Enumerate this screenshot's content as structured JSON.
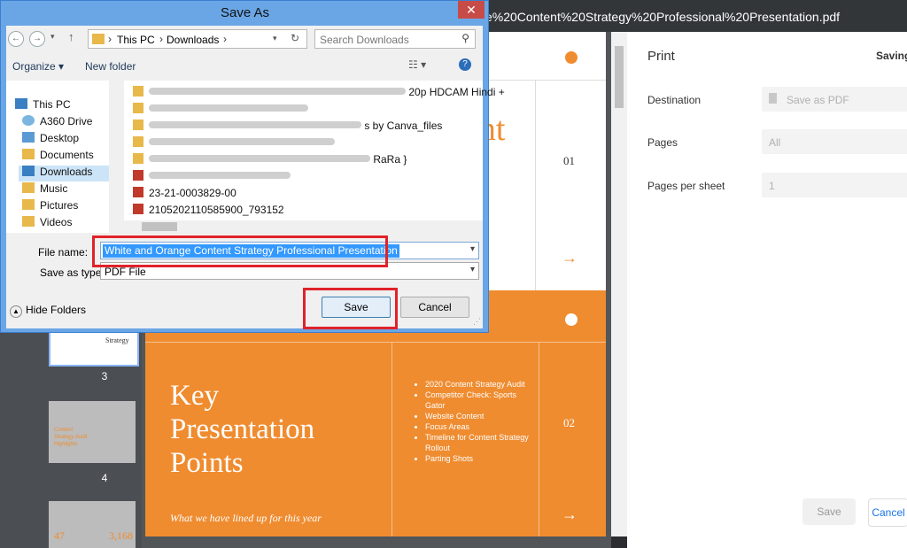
{
  "pdf_title": "e%20Content%20Strategy%20Professional%20Presentation.pdf",
  "thumb_numbers": [
    "3",
    "4"
  ],
  "thumb_texts": {
    "t1": "Strategy",
    "t2a": "Content",
    "t2b": "Strategy Audit",
    "t2c": "Highlights",
    "t3a": "47",
    "t3b": "3,168"
  },
  "slide1": {
    "title_part": "ent",
    "number": "01",
    "arrow": "→"
  },
  "slide2": {
    "title_lines": [
      "Key",
      "Presentation",
      "Points"
    ],
    "subtitle": "What we have lined up for this year",
    "bullets": [
      "2020 Content Strategy Audit",
      "Competitor Check: Sports Gator",
      "Website Content",
      "Focus Areas",
      "Timeline for Content Strategy Rollout",
      "Parting Shots"
    ],
    "number": "02",
    "arrow": "→"
  },
  "print": {
    "title": "Print",
    "saving": "Saving",
    "destination_label": "Destination",
    "destination_value": "Save as PDF",
    "pages_label": "Pages",
    "pages_value": "All",
    "pps_label": "Pages per sheet",
    "pps_value": "1",
    "save": "Save",
    "cancel": "Cancel"
  },
  "dialog": {
    "title": "Save As",
    "close": "✕",
    "breadcrumb": [
      "This PC",
      "Downloads"
    ],
    "search_placeholder": "Search Downloads",
    "organize": "Organize ▾",
    "new_folder": "New folder",
    "nav_items": [
      "This PC",
      "A360 Drive",
      "Desktop",
      "Documents",
      "Downloads",
      "Music",
      "Pictures",
      "Videos"
    ],
    "files": [
      {
        "type": "folder",
        "text": "20p HDCAM Hindi +"
      },
      {
        "type": "folder",
        "text": ""
      },
      {
        "type": "folder",
        "text": "s by Canva_files"
      },
      {
        "type": "folder",
        "text": ""
      },
      {
        "type": "folder",
        "text": "RaRa }"
      },
      {
        "type": "pdf",
        "text": ""
      },
      {
        "type": "pdf",
        "text": "23-21-0003829-00"
      },
      {
        "type": "pdf",
        "text": "2105202110585900_793152"
      }
    ],
    "file_name_label": "File name:",
    "file_name_value": "White and Orange Content Strategy Professional Presentation",
    "save_type_label": "Save as type:",
    "save_type_value": "PDF File",
    "hide_folders": "Hide Folders",
    "save": "Save",
    "cancel": "Cancel"
  },
  "colors": {
    "accent_orange": "#ef8c30",
    "highlight_red": "#e0222a",
    "selection_blue": "#3399ff"
  }
}
